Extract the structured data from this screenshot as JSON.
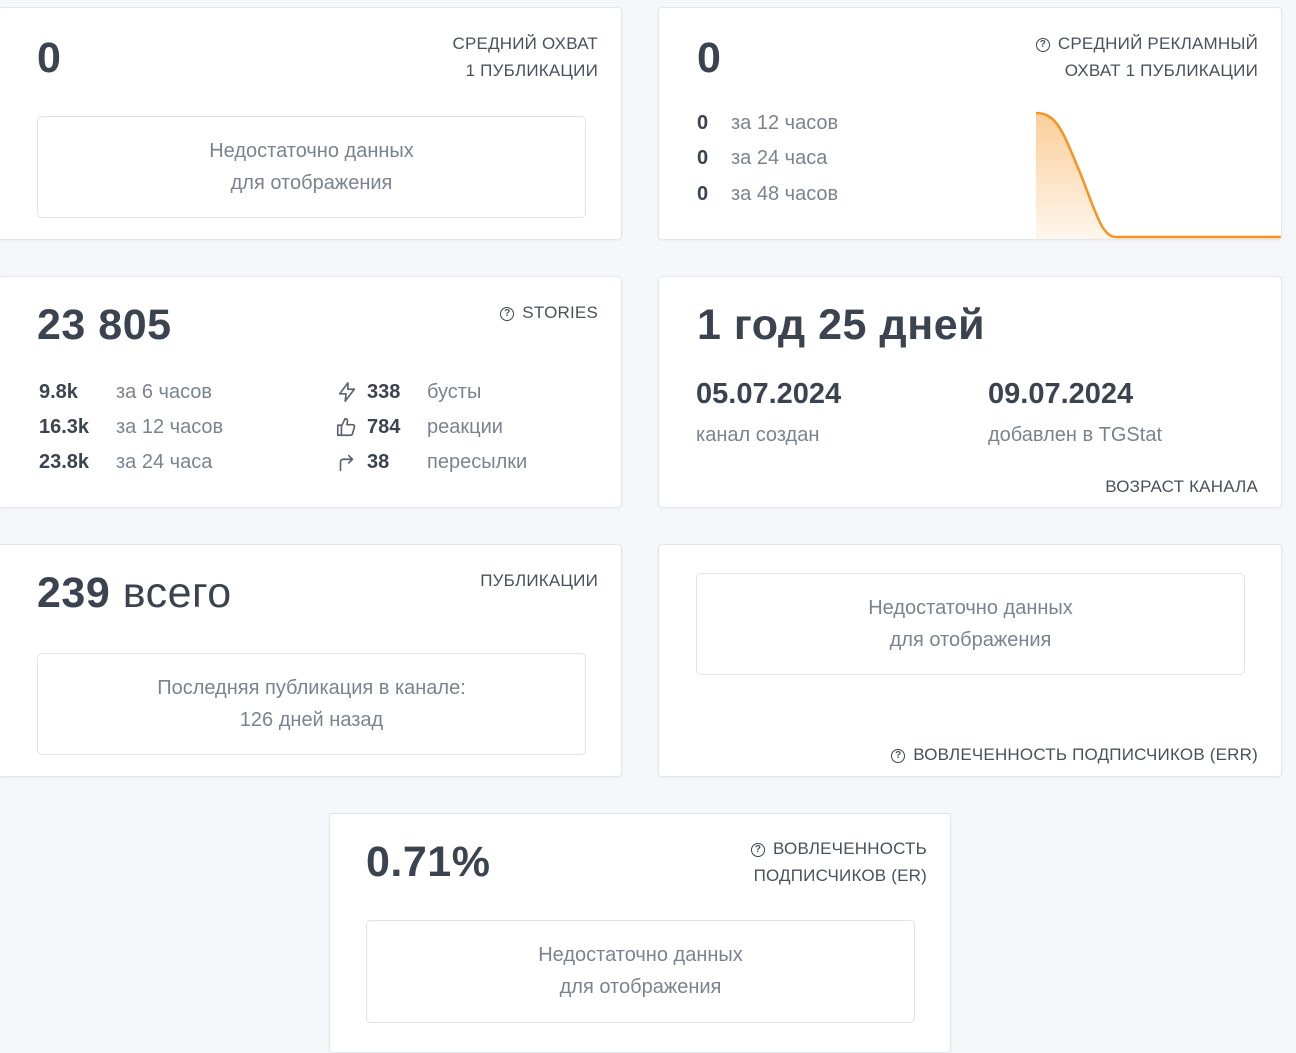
{
  "avg_reach": {
    "value": "0",
    "label_line1": "СРЕДНИЙ ОХВАТ",
    "label_line2": "1 ПУБЛИКАЦИИ",
    "nodata_line1": "Недостаточно данных",
    "nodata_line2": "для отображения"
  },
  "ad_reach": {
    "value": "0",
    "label_line1": "СРЕДНИЙ РЕКЛАМНЫЙ",
    "label_line2": "ОХВАТ 1 ПУБЛИКАЦИИ",
    "rows": [
      {
        "value": "0",
        "text": "за 12 часов"
      },
      {
        "value": "0",
        "text": "за 24 часа"
      },
      {
        "value": "0",
        "text": "за 48 часов"
      }
    ],
    "spark_color": "#f7931e"
  },
  "stories": {
    "value": "23 805",
    "label": "STORIES",
    "views": [
      {
        "value": "9.8k",
        "text": "за 6 часов"
      },
      {
        "value": "16.3k",
        "text": "за 12 часов"
      },
      {
        "value": "23.8k",
        "text": "за 24 часа"
      }
    ],
    "stats": [
      {
        "icon": "lightning-icon",
        "value": "338",
        "text": "бусты"
      },
      {
        "icon": "thumbs-up-icon",
        "value": "784",
        "text": "реакции"
      },
      {
        "icon": "share-arrow-icon",
        "value": "38",
        "text": "пересылки"
      }
    ]
  },
  "channel_age": {
    "value": "1 год 25 дней",
    "created_date": "05.07.2024",
    "created_label": "канал создан",
    "added_date": "09.07.2024",
    "added_label": "добавлен в TGStat",
    "label": "ВОЗРАСТ КАНАЛА"
  },
  "publications": {
    "value_num": "239",
    "value_suffix": "всего",
    "label": "ПУБЛИКАЦИИ",
    "last_line1": "Последняя публикация в канале:",
    "last_line2": "126 дней назад"
  },
  "err": {
    "label": "ВОВЛЕЧЕННОСТЬ ПОДПИСЧИКОВ (ERR)",
    "nodata_line1": "Недостаточно данных",
    "nodata_line2": "для отображения"
  },
  "er": {
    "value": "0.71%",
    "label_line1": "ВОВЛЕЧЕННОСТЬ",
    "label_line2": "ПОДПИСЧИКОВ (ER)",
    "nodata_line1": "Недостаточно данных",
    "nodata_line2": "для отображения"
  },
  "colors": {
    "accent_orange": "#f7931e",
    "text_dark": "#3c4350",
    "text_muted": "#7b8290"
  }
}
